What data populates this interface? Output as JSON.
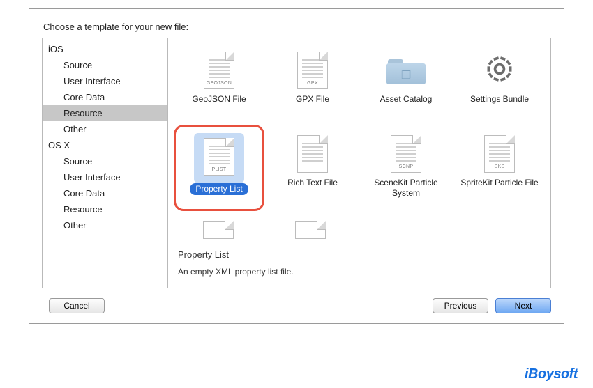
{
  "prompt": "Choose a template for your new file:",
  "sidebar": {
    "groups": [
      {
        "heading": "iOS",
        "items": [
          {
            "label": "Source",
            "selected": false
          },
          {
            "label": "User Interface",
            "selected": false
          },
          {
            "label": "Core Data",
            "selected": false
          },
          {
            "label": "Resource",
            "selected": true
          },
          {
            "label": "Other",
            "selected": false
          }
        ]
      },
      {
        "heading": "OS X",
        "items": [
          {
            "label": "Source",
            "selected": false
          },
          {
            "label": "User Interface",
            "selected": false
          },
          {
            "label": "Core Data",
            "selected": false
          },
          {
            "label": "Resource",
            "selected": false
          },
          {
            "label": "Other",
            "selected": false
          }
        ]
      }
    ]
  },
  "templates": [
    {
      "label": "GeoJSON File",
      "badge": "GEOJSON",
      "icon": "file",
      "selected": false
    },
    {
      "label": "GPX File",
      "badge": "GPX",
      "icon": "file",
      "selected": false
    },
    {
      "label": "Asset Catalog",
      "badge": "",
      "icon": "folder",
      "selected": false
    },
    {
      "label": "Settings Bundle",
      "badge": "",
      "icon": "gear",
      "selected": false
    },
    {
      "label": "Property List",
      "badge": "PLIST",
      "icon": "file",
      "selected": true
    },
    {
      "label": "Rich Text File",
      "badge": "",
      "icon": "file",
      "selected": false
    },
    {
      "label": "SceneKit Particle System",
      "badge": "SCNP",
      "icon": "file",
      "selected": false
    },
    {
      "label": "SpriteKit Particle File",
      "badge": "SKS",
      "icon": "file",
      "selected": false
    }
  ],
  "description": {
    "title": "Property List",
    "body": "An empty XML property list file."
  },
  "buttons": {
    "cancel": "Cancel",
    "previous": "Previous",
    "next": "Next"
  },
  "watermark": "iBoysoft"
}
